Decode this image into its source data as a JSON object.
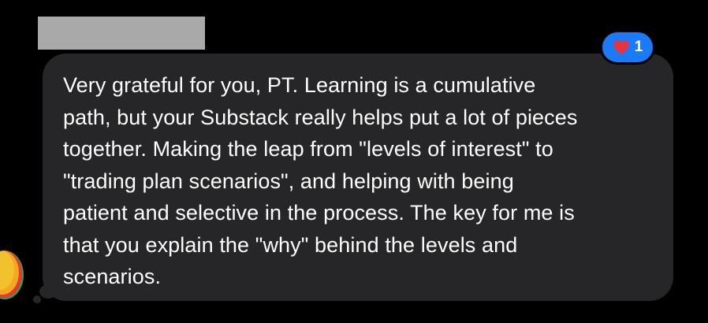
{
  "message": {
    "text": "Very grateful for you, PT. Learning is a cumulative\npath, but your Substack really helps put a lot of pieces\ntogether. Making the leap from \"levels of interest\" to\n\"trading plan scenarios\", and helping with being\npatient and selective in the process. The key for me is\nthat you explain the \"why\" behind the levels and\nscenarios."
  },
  "reaction": {
    "icon": "heart-icon",
    "count": "1",
    "color": "#1a7af8",
    "heart_color": "#e8323c"
  },
  "colors": {
    "background": "#000000",
    "bubble": "#262628",
    "text": "#ffffff",
    "redaction": "#a9a9a9"
  }
}
